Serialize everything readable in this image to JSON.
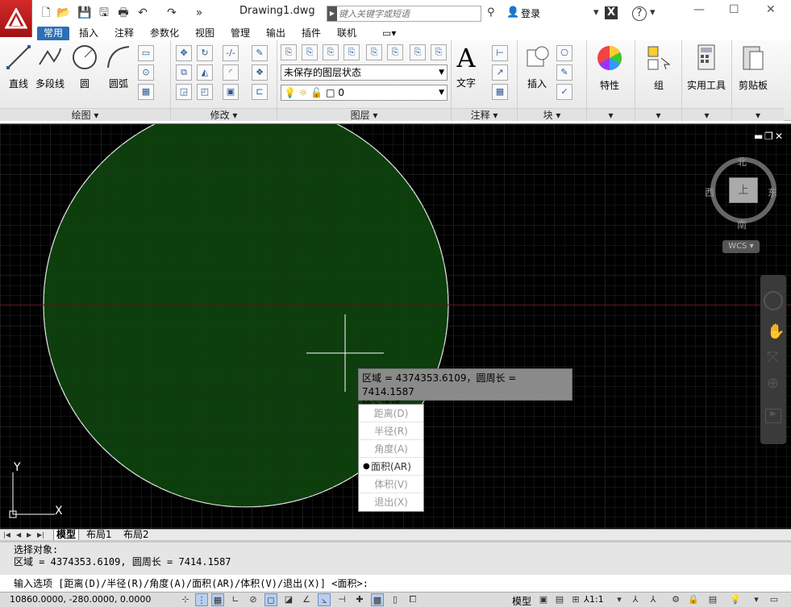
{
  "app": {
    "document_title": "Drawing1.dwg",
    "search_placeholder": "键入关键字或短语",
    "login_label": "登录"
  },
  "ribbon_tabs": [
    "常用",
    "插入",
    "注释",
    "参数化",
    "视图",
    "管理",
    "输出",
    "插件",
    "联机"
  ],
  "ribbon": {
    "draw": {
      "line": "直线",
      "polyline": "多段线",
      "circle": "圆",
      "arc": "圆弧",
      "panel_label": "绘图 ▾"
    },
    "modify": {
      "panel_label": "修改 ▾"
    },
    "layers": {
      "layer_state": "未保存的图层状态",
      "current_layer": "0",
      "panel_label": "图层 ▾"
    },
    "annotation": {
      "text": "文字",
      "panel_label": "注释 ▾"
    },
    "block": {
      "insert": "插入",
      "panel_label": "块 ▾"
    },
    "properties": {
      "label": "特性"
    },
    "groups": {
      "label": "组"
    },
    "utilities": {
      "label": "实用工具"
    },
    "clipboard": {
      "label": "剪贴板"
    }
  },
  "viewcube": {
    "north": "北",
    "south": "南",
    "west": "西",
    "east": "东",
    "top": "上",
    "wcs": "WCS"
  },
  "tooltip": {
    "line1": "区域 = 4374353.6109，圆周长 = 7414.1587",
    "line2": "输入选项"
  },
  "dynamic_menu": [
    {
      "label": "距离(D)",
      "selected": false
    },
    {
      "label": "半径(R)",
      "selected": false
    },
    {
      "label": "角度(A)",
      "selected": false
    },
    {
      "label": "面积(AR)",
      "selected": true
    },
    {
      "label": "体积(V)",
      "selected": false
    },
    {
      "label": "退出(X)",
      "selected": false
    }
  ],
  "layout_tabs": [
    "模型",
    "布局1",
    "布局2"
  ],
  "command": {
    "history_1": "选择对象:",
    "history_2": "区域 = 4374353.6109, 圆周长 = 7414.1587",
    "prompt": "输入选项 [距离(D)/半径(R)/角度(A)/面积(AR)/体积(V)/退出(X)] <面积>:"
  },
  "status": {
    "coordinates": "10860.0000, -280.0000, 0.0000",
    "model": "模型",
    "scale": "1:1"
  },
  "ucs": {
    "x": "X",
    "y": "Y"
  },
  "colors": {
    "circle_fill": "#0c3f0c",
    "canvas_bg": "#000000",
    "ribbon_active_tab": "#2c6fb5"
  }
}
